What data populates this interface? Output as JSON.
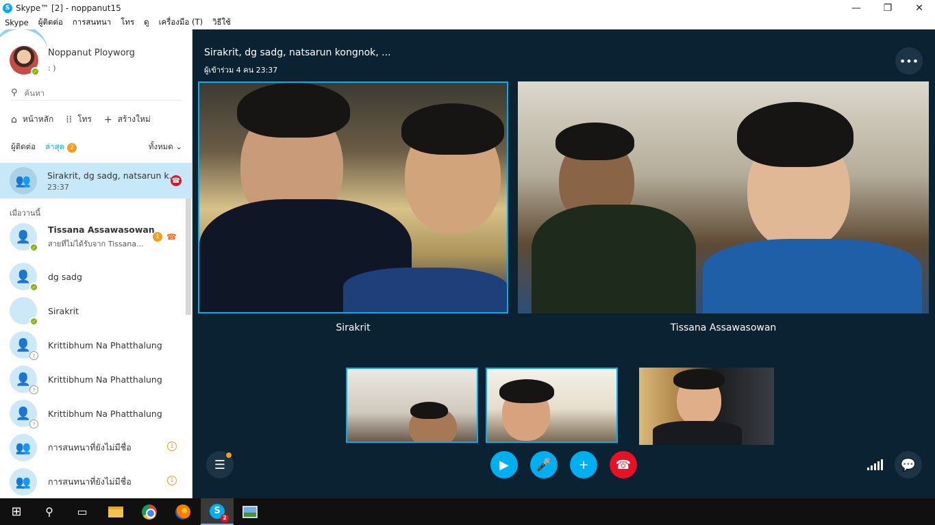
{
  "window": {
    "title": "Skype™ [2] - noppanut15",
    "app_icon_letter": "S",
    "controls": {
      "minimize": "—",
      "restore": "❐",
      "close": "✕"
    }
  },
  "menu": [
    "Skype",
    "ผู้ติดต่อ",
    "การสนทนา",
    "โทร",
    "ดู",
    "เครื่องมือ (T)",
    "วิธีใช้"
  ],
  "sidebar": {
    "profile": {
      "name": "Noppanut Ployworg",
      "mood": ": )"
    },
    "search": {
      "placeholder": "ค้นหา"
    },
    "nav": {
      "home": "หน้าหลัก",
      "call": "โทร",
      "create": "สร้างใหม่"
    },
    "tabs": {
      "contacts": "ผู้ติดต่อ",
      "recent": "ล่าสุด",
      "recent_badge": "2",
      "filter": "ทั้งหมด"
    },
    "active_conversation": {
      "title": "Sirakrit, dg sadg, natsarun k...",
      "time": "23:37"
    },
    "section_yesterday": "เมื่อวานนี้",
    "contacts": [
      {
        "name": "Tissana Assawasowan",
        "sub": "สายที่ไม่ได้รับจาก Tissana...",
        "badge": "1"
      },
      {
        "name": "dg sadg"
      },
      {
        "name": "Sirakrit"
      },
      {
        "name": "Krittibhum Na Phatthalung"
      },
      {
        "name": "Krittibhum Na Phatthalung"
      },
      {
        "name": "Krittibhum Na Phatthalung"
      },
      {
        "name": "การสนทนาที่ยังไม่มีชื่อ",
        "badge": "1"
      },
      {
        "name": "การสนทนาที่ยังไม่มีชื่อ",
        "badge": "1"
      }
    ]
  },
  "call": {
    "title": "Sirakrit, dg sadg, natsarun kongnok, ...",
    "subtitle": "ผู้เข้าร่วม 4 คน   23:37",
    "participants": {
      "left": "Sirakrit",
      "right": "Tissana Assawasowan"
    }
  },
  "colors": {
    "skype_blue": "#00aff0",
    "call_bg": "#0b2233",
    "end_red": "#e81123",
    "badge_orange": "#f89c1c"
  }
}
